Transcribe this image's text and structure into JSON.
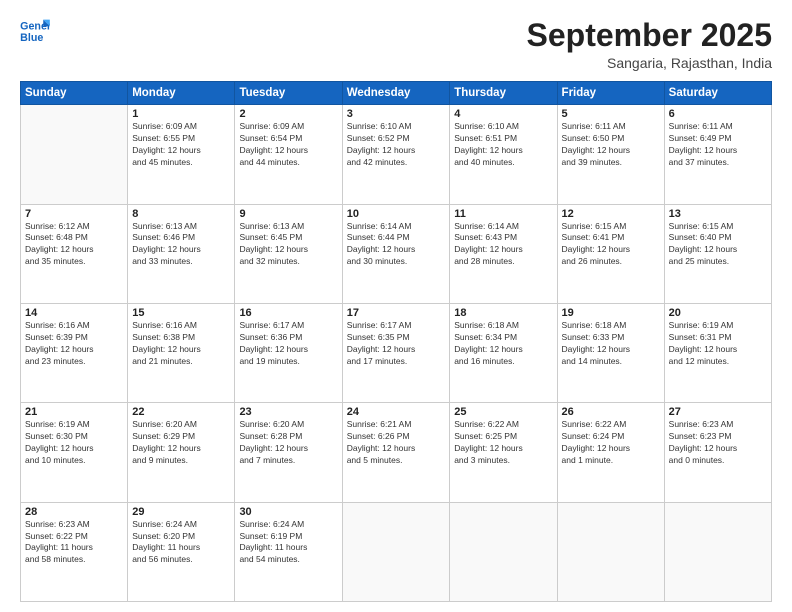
{
  "logo": {
    "line1": "General",
    "line2": "Blue"
  },
  "title": "September 2025",
  "location": "Sangaria, Rajasthan, India",
  "days_of_week": [
    "Sunday",
    "Monday",
    "Tuesday",
    "Wednesday",
    "Thursday",
    "Friday",
    "Saturday"
  ],
  "weeks": [
    [
      {
        "day": "",
        "info": ""
      },
      {
        "day": "1",
        "info": "Sunrise: 6:09 AM\nSunset: 6:55 PM\nDaylight: 12 hours\nand 45 minutes."
      },
      {
        "day": "2",
        "info": "Sunrise: 6:09 AM\nSunset: 6:54 PM\nDaylight: 12 hours\nand 44 minutes."
      },
      {
        "day": "3",
        "info": "Sunrise: 6:10 AM\nSunset: 6:52 PM\nDaylight: 12 hours\nand 42 minutes."
      },
      {
        "day": "4",
        "info": "Sunrise: 6:10 AM\nSunset: 6:51 PM\nDaylight: 12 hours\nand 40 minutes."
      },
      {
        "day": "5",
        "info": "Sunrise: 6:11 AM\nSunset: 6:50 PM\nDaylight: 12 hours\nand 39 minutes."
      },
      {
        "day": "6",
        "info": "Sunrise: 6:11 AM\nSunset: 6:49 PM\nDaylight: 12 hours\nand 37 minutes."
      }
    ],
    [
      {
        "day": "7",
        "info": "Sunrise: 6:12 AM\nSunset: 6:48 PM\nDaylight: 12 hours\nand 35 minutes."
      },
      {
        "day": "8",
        "info": "Sunrise: 6:13 AM\nSunset: 6:46 PM\nDaylight: 12 hours\nand 33 minutes."
      },
      {
        "day": "9",
        "info": "Sunrise: 6:13 AM\nSunset: 6:45 PM\nDaylight: 12 hours\nand 32 minutes."
      },
      {
        "day": "10",
        "info": "Sunrise: 6:14 AM\nSunset: 6:44 PM\nDaylight: 12 hours\nand 30 minutes."
      },
      {
        "day": "11",
        "info": "Sunrise: 6:14 AM\nSunset: 6:43 PM\nDaylight: 12 hours\nand 28 minutes."
      },
      {
        "day": "12",
        "info": "Sunrise: 6:15 AM\nSunset: 6:41 PM\nDaylight: 12 hours\nand 26 minutes."
      },
      {
        "day": "13",
        "info": "Sunrise: 6:15 AM\nSunset: 6:40 PM\nDaylight: 12 hours\nand 25 minutes."
      }
    ],
    [
      {
        "day": "14",
        "info": "Sunrise: 6:16 AM\nSunset: 6:39 PM\nDaylight: 12 hours\nand 23 minutes."
      },
      {
        "day": "15",
        "info": "Sunrise: 6:16 AM\nSunset: 6:38 PM\nDaylight: 12 hours\nand 21 minutes."
      },
      {
        "day": "16",
        "info": "Sunrise: 6:17 AM\nSunset: 6:36 PM\nDaylight: 12 hours\nand 19 minutes."
      },
      {
        "day": "17",
        "info": "Sunrise: 6:17 AM\nSunset: 6:35 PM\nDaylight: 12 hours\nand 17 minutes."
      },
      {
        "day": "18",
        "info": "Sunrise: 6:18 AM\nSunset: 6:34 PM\nDaylight: 12 hours\nand 16 minutes."
      },
      {
        "day": "19",
        "info": "Sunrise: 6:18 AM\nSunset: 6:33 PM\nDaylight: 12 hours\nand 14 minutes."
      },
      {
        "day": "20",
        "info": "Sunrise: 6:19 AM\nSunset: 6:31 PM\nDaylight: 12 hours\nand 12 minutes."
      }
    ],
    [
      {
        "day": "21",
        "info": "Sunrise: 6:19 AM\nSunset: 6:30 PM\nDaylight: 12 hours\nand 10 minutes."
      },
      {
        "day": "22",
        "info": "Sunrise: 6:20 AM\nSunset: 6:29 PM\nDaylight: 12 hours\nand 9 minutes."
      },
      {
        "day": "23",
        "info": "Sunrise: 6:20 AM\nSunset: 6:28 PM\nDaylight: 12 hours\nand 7 minutes."
      },
      {
        "day": "24",
        "info": "Sunrise: 6:21 AM\nSunset: 6:26 PM\nDaylight: 12 hours\nand 5 minutes."
      },
      {
        "day": "25",
        "info": "Sunrise: 6:22 AM\nSunset: 6:25 PM\nDaylight: 12 hours\nand 3 minutes."
      },
      {
        "day": "26",
        "info": "Sunrise: 6:22 AM\nSunset: 6:24 PM\nDaylight: 12 hours\nand 1 minute."
      },
      {
        "day": "27",
        "info": "Sunrise: 6:23 AM\nSunset: 6:23 PM\nDaylight: 12 hours\nand 0 minutes."
      }
    ],
    [
      {
        "day": "28",
        "info": "Sunrise: 6:23 AM\nSunset: 6:22 PM\nDaylight: 11 hours\nand 58 minutes."
      },
      {
        "day": "29",
        "info": "Sunrise: 6:24 AM\nSunset: 6:20 PM\nDaylight: 11 hours\nand 56 minutes."
      },
      {
        "day": "30",
        "info": "Sunrise: 6:24 AM\nSunset: 6:19 PM\nDaylight: 11 hours\nand 54 minutes."
      },
      {
        "day": "",
        "info": ""
      },
      {
        "day": "",
        "info": ""
      },
      {
        "day": "",
        "info": ""
      },
      {
        "day": "",
        "info": ""
      }
    ]
  ]
}
